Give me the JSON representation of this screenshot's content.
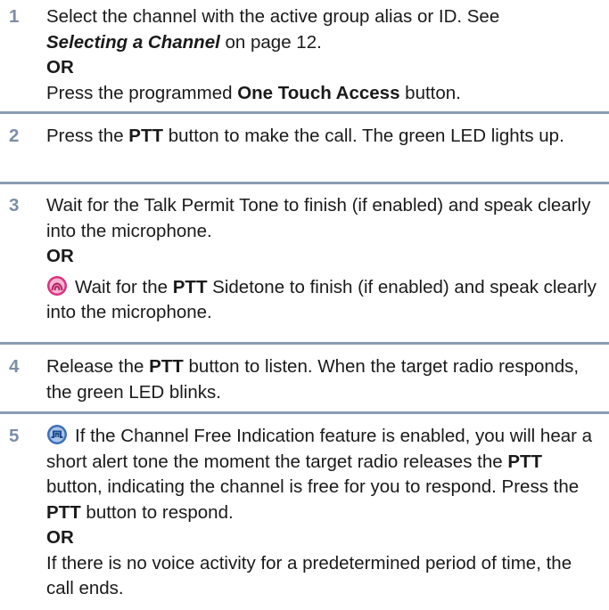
{
  "steps": [
    {
      "number": "1",
      "line1": "Select the channel with the active group alias or ID. See",
      "link_text": "Selecting a Channel",
      "link_after": " on page 12.",
      "or": "OR",
      "alt_before": "Press the programmed ",
      "alt_bold": "One Touch Access",
      "alt_after": " button."
    },
    {
      "number": "2",
      "before": "Press the ",
      "bold": "PTT",
      "after": " button to make the call. The green LED lights up."
    },
    {
      "number": "3",
      "text": "Wait for the Talk Permit Tone to finish (if enabled) and speak clearly into the microphone.",
      "or": "OR",
      "alt_before": "Wait for the ",
      "alt_bold": "PTT",
      "alt_after": " Sidetone to finish (if enabled) and speak clearly into the microphone.",
      "icon": "analog-mode-icon"
    },
    {
      "number": "4",
      "before": "Release the ",
      "bold": "PTT",
      "after": " button to listen. When the target radio responds, the green LED blinks."
    },
    {
      "number": "5",
      "icon": "digital-mode-icon",
      "p1_before": "If the Channel Free Indication feature is enabled, you will hear a short alert tone the moment the target radio releases the ",
      "p1_bold1": "PTT",
      "p1_mid": " button, indicating the channel is free for you to respond. Press the ",
      "p1_bold2": "PTT",
      "p1_after": " button to respond.",
      "or": "OR",
      "p2": "If there is no voice activity for a predetermined period of time, the call ends."
    }
  ],
  "colors": {
    "step_number": "#7c8ea6",
    "divider": "#8a9db3",
    "analog_icon": "#d8337f",
    "digital_icon": "#3e6fb6"
  }
}
